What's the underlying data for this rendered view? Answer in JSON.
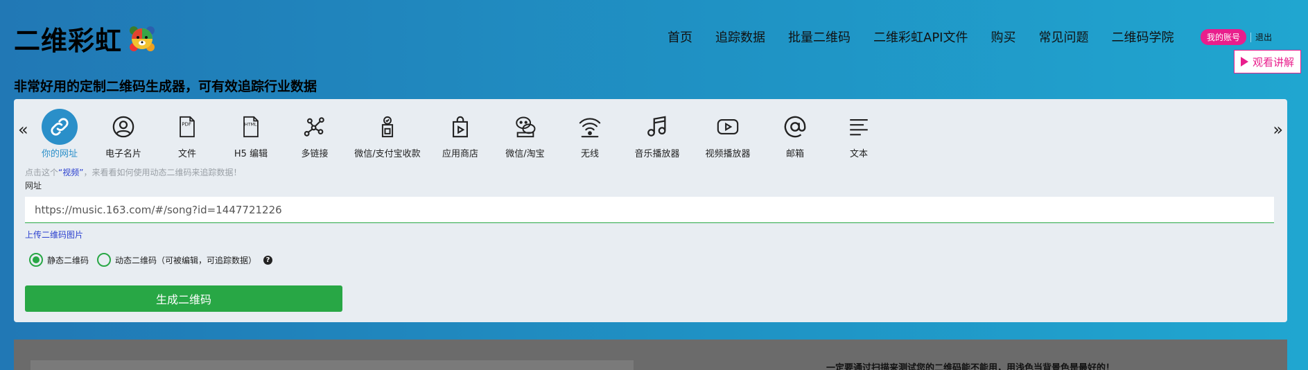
{
  "header": {
    "logo_text": "二维彩虹",
    "nav": [
      "首页",
      "追踪数据",
      "批量二维码",
      "二维彩虹API文件",
      "购买",
      "常见问题",
      "二维码学院"
    ],
    "account_label": "我的账号",
    "logout_label": "退出",
    "watch_label": "观看讲解"
  },
  "tagline": "非常好用的定制二维码生成器，可有效追踪行业数据",
  "types": [
    {
      "label": "你的网址",
      "icon": "link-icon",
      "active": true
    },
    {
      "label": "电子名片",
      "icon": "user-icon"
    },
    {
      "label": "文件",
      "icon": "pdf-icon"
    },
    {
      "label": "H5 编辑",
      "icon": "html-icon"
    },
    {
      "label": "多链接",
      "icon": "multilink-icon"
    },
    {
      "label": "微信/支付宝收款",
      "icon": "payment-icon"
    },
    {
      "label": "应用商店",
      "icon": "app-store-icon"
    },
    {
      "label": "微信/淘宝",
      "icon": "wechat-icon"
    },
    {
      "label": "无线",
      "icon": "wifi-icon"
    },
    {
      "label": "音乐播放器",
      "icon": "music-icon"
    },
    {
      "label": "视频播放器",
      "icon": "video-icon"
    },
    {
      "label": "邮箱",
      "icon": "at-icon"
    },
    {
      "label": "文本",
      "icon": "text-icon"
    }
  ],
  "form": {
    "hint_prefix": "点击这个",
    "hint_link": "“视频”",
    "hint_suffix": "，来看看如何使用动态二维码来追踪数据！",
    "field_label": "网址",
    "url_value": "https://music.163.com/#/song?id=1447721226",
    "upload_label": "上传二维码图片",
    "radio_static": "静态二维码",
    "radio_dynamic": "动态二维码（可被编辑，可追踪数据）",
    "generate_label": "生成二维码"
  },
  "lower": {
    "notice": "一定要通过扫描来测试您的二维码能不能用，用浅色当背景色是最好的！"
  },
  "colors": {
    "accent": "#2a8fc9",
    "green": "#28a745",
    "pink": "#e91e8c"
  }
}
